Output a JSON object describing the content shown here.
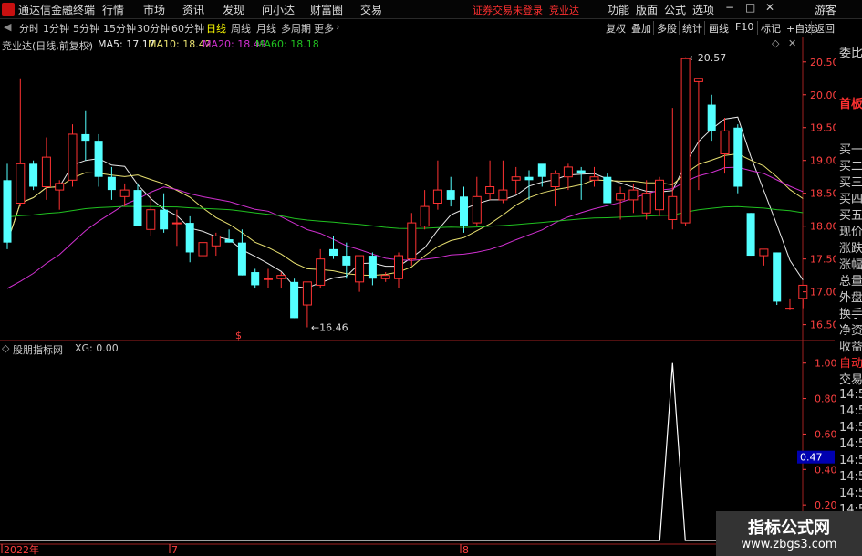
{
  "app": {
    "title": "通达信金融终端",
    "warning": "证券交易未登录",
    "broker": "竞业达"
  },
  "menu": [
    "行情",
    "市场",
    "资讯",
    "发现",
    "问小达",
    "财富圈",
    "交易"
  ],
  "rmenu": [
    "功能",
    "版面",
    "公式",
    "选项",
    "游客"
  ],
  "periods": [
    "分时",
    "1分钟",
    "5分钟",
    "15分钟",
    "30分钟",
    "60分钟",
    "日线",
    "周线",
    "月线",
    "多周期",
    "更多"
  ],
  "active_period": "日线",
  "tools": [
    "复权",
    "叠加",
    "多股",
    "统计",
    "画线",
    "F10",
    "标记",
    "+自选",
    "返回"
  ],
  "info": {
    "title": "竞业达(日线,前复权)",
    "ma5": "MA5: 17.17",
    "ma10": "MA10: 18.42",
    "ma20": "MA20: 18.49",
    "ma60": "MA60: 18.18"
  },
  "indicator": {
    "name": "股朋指标网",
    "xg": "XG: 0.00"
  },
  "side": {
    "labels": [
      "委比",
      "首板",
      "买一",
      "买二",
      "买三",
      "买四",
      "买五",
      "现价",
      "涨跌",
      "涨幅",
      "总量",
      "外盘",
      "换手",
      "净资",
      "收益",
      "自动",
      "交易",
      "14:55",
      "14:5",
      "14:5",
      "14:5",
      "14:5",
      "14:5",
      "14:5",
      "14:5",
      "14:5",
      "14:5"
    ]
  },
  "dates": {
    "d1": "2022年",
    "d2": "7",
    "d3": "8"
  },
  "marker": "$",
  "watermark": {
    "line1": "指标公式网",
    "line2": "www.zbgs3.com"
  },
  "colors": {
    "up": "#ff3232",
    "down": "#54ffff",
    "ma5": "#e8e8e8",
    "ma10": "#e8e070",
    "ma20": "#d030d0",
    "ma60": "#20c020",
    "axis": "#ff4040"
  },
  "chart_data": [
    {
      "type": "candlestick",
      "title": "竞业达(日线,前复权)",
      "ylim": [
        16.3,
        20.65
      ],
      "y_ticks": [
        16.5,
        17.0,
        17.5,
        18.0,
        18.5,
        19.0,
        19.5,
        20.0,
        20.5
      ],
      "annotations": [
        {
          "label": "20.57",
          "value": 20.57
        },
        {
          "label": "16.46",
          "value": 16.46
        }
      ],
      "candles": [
        [
          18.7,
          18.95,
          17.65,
          17.75
        ],
        [
          18.35,
          20.25,
          18.3,
          18.95
        ],
        [
          18.95,
          19.0,
          18.55,
          18.6
        ],
        [
          18.6,
          19.35,
          18.4,
          19.05
        ],
        [
          18.55,
          18.7,
          18.25,
          18.65
        ],
        [
          18.7,
          19.55,
          18.6,
          19.4
        ],
        [
          19.4,
          19.75,
          19.0,
          19.3
        ],
        [
          19.3,
          19.4,
          18.6,
          18.75
        ],
        [
          18.75,
          18.9,
          18.4,
          18.55
        ],
        [
          18.45,
          18.65,
          18.3,
          18.55
        ],
        [
          18.55,
          18.65,
          18.0,
          18.0
        ],
        [
          17.95,
          18.5,
          17.85,
          18.25
        ],
        [
          18.25,
          18.5,
          17.9,
          17.95
        ],
        [
          18.05,
          18.25,
          17.7,
          18.05
        ],
        [
          18.05,
          18.15,
          17.45,
          17.6
        ],
        [
          17.55,
          17.9,
          17.45,
          17.75
        ],
        [
          17.7,
          17.9,
          17.55,
          17.85
        ],
        [
          17.8,
          17.95,
          17.75,
          17.75
        ],
        [
          17.75,
          17.95,
          17.25,
          17.25
        ],
        [
          17.3,
          17.35,
          17.05,
          17.1
        ],
        [
          17.2,
          17.35,
          17.05,
          17.2
        ],
        [
          17.2,
          17.3,
          17.05,
          17.25
        ],
        [
          17.15,
          17.2,
          16.6,
          16.6
        ],
        [
          16.8,
          17.15,
          16.46,
          17.15
        ],
        [
          17.1,
          17.65,
          17.05,
          17.5
        ],
        [
          17.65,
          17.85,
          17.5,
          17.55
        ],
        [
          17.55,
          17.75,
          17.2,
          17.4
        ],
        [
          17.15,
          17.4,
          17.0,
          17.55
        ],
        [
          17.55,
          17.6,
          17.1,
          17.2
        ],
        [
          17.2,
          17.3,
          17.15,
          17.25
        ],
        [
          17.2,
          17.6,
          17.05,
          17.55
        ],
        [
          17.5,
          18.2,
          17.4,
          18.05
        ],
        [
          18.0,
          18.55,
          17.95,
          18.3
        ],
        [
          18.35,
          19.0,
          18.25,
          18.55
        ],
        [
          18.55,
          18.75,
          18.3,
          18.4
        ],
        [
          18.45,
          18.6,
          17.9,
          18.0
        ],
        [
          18.05,
          18.75,
          18.0,
          18.45
        ],
        [
          18.5,
          19.0,
          18.4,
          18.6
        ],
        [
          18.4,
          19.0,
          18.35,
          18.55
        ],
        [
          18.7,
          18.9,
          18.5,
          18.75
        ],
        [
          18.75,
          18.85,
          18.4,
          18.7
        ],
        [
          18.95,
          18.8,
          18.6,
          18.75
        ],
        [
          18.6,
          18.85,
          18.3,
          18.8
        ],
        [
          18.75,
          18.95,
          18.55,
          18.9
        ],
        [
          18.85,
          18.9,
          18.4,
          18.8
        ],
        [
          18.7,
          18.9,
          18.6,
          18.75
        ],
        [
          18.75,
          18.8,
          18.35,
          18.35
        ],
        [
          18.4,
          18.6,
          18.1,
          18.5
        ],
        [
          18.4,
          18.65,
          18.2,
          18.55
        ],
        [
          18.2,
          18.7,
          18.1,
          18.5
        ],
        [
          18.25,
          18.75,
          18.15,
          18.7
        ],
        [
          18.1,
          19.8,
          17.95,
          18.45
        ],
        [
          18.05,
          20.57,
          18.0,
          20.55
        ],
        [
          20.2,
          20.25,
          18.55,
          20.25
        ],
        [
          19.85,
          20.0,
          19.3,
          19.45
        ],
        [
          19.1,
          19.65,
          18.8,
          19.45
        ],
        [
          19.5,
          19.55,
          18.5,
          18.6
        ],
        [
          18.2,
          18.2,
          17.55,
          17.55
        ],
        [
          17.55,
          17.65,
          17.4,
          17.65
        ],
        [
          17.6,
          17.6,
          16.8,
          16.85
        ],
        [
          16.75,
          16.9,
          16.72,
          16.75
        ],
        [
          16.9,
          17.1,
          16.75,
          17.1
        ]
      ]
    },
    {
      "type": "line",
      "title": "股朋指标网",
      "series": [
        {
          "name": "XG",
          "values": [
            {
              "candle_index": 51,
              "value": 1.0
            }
          ]
        }
      ],
      "ylim": [
        0,
        1.05
      ],
      "y_ticks": [
        0.2,
        0.4,
        0.6,
        0.8,
        1.0
      ],
      "current": 0.47,
      "current_label": "0.47"
    }
  ]
}
